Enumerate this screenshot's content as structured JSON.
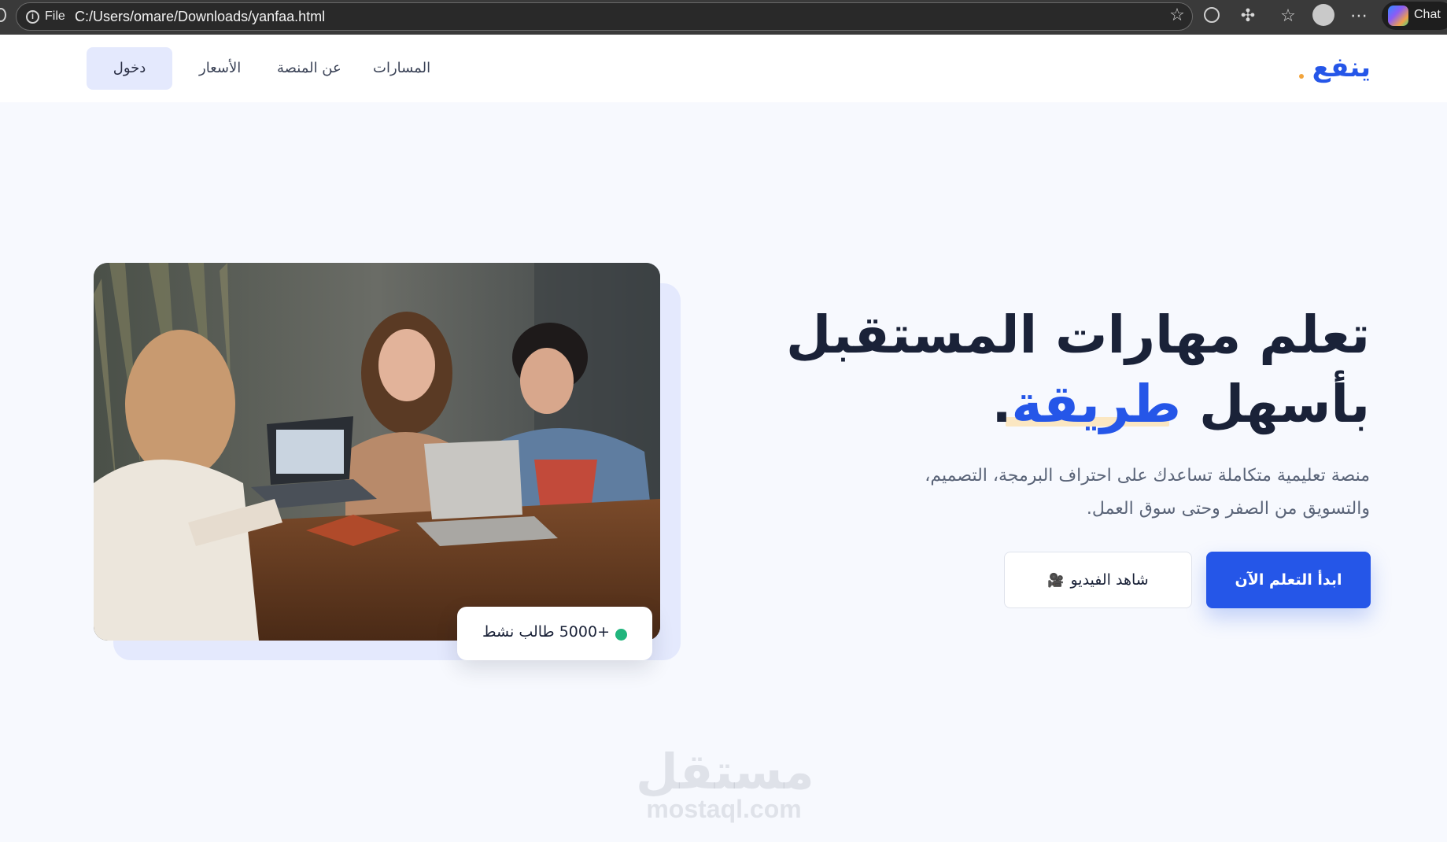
{
  "browser": {
    "file_label": "File",
    "url": "C:/Users/omare/Downloads/yanfaa.html",
    "chat_label": "Chat",
    "icons": [
      "info-icon",
      "star-icon",
      "globe-icon",
      "extensions-icon",
      "favorites-icon",
      "profile-avatar",
      "more-icon",
      "copilot-icon"
    ]
  },
  "nav": {
    "logo": "ينفع",
    "links": [
      "المسارات",
      "عن المنصة",
      "الأسعار"
    ],
    "login": "دخول"
  },
  "hero": {
    "title_line1": "تعلم مهارات المستقبل",
    "title_line2_start": "بأسهل ",
    "title_accent": "طريقة",
    "title_end": ".",
    "subtitle_line1": "منصة تعليمية متكاملة تساعدك على احتراف البرمجة، التصميم،",
    "subtitle_line2": "والتسويق من الصفر وحتى سوق العمل.",
    "primary_button": "ابدأ التعلم الآن",
    "secondary_button": "شاهد الفيديو",
    "secondary_icon": "video-camera-icon",
    "stat": "+5000 طالب نشط"
  },
  "watermark": {
    "arabic": "مستقل",
    "latin": "mostaql.com"
  },
  "colors": {
    "brand": "#2556e8",
    "accent_dot": "#f2a43b",
    "status_green": "#21b57d",
    "page_bg": "#f7f9fe"
  }
}
